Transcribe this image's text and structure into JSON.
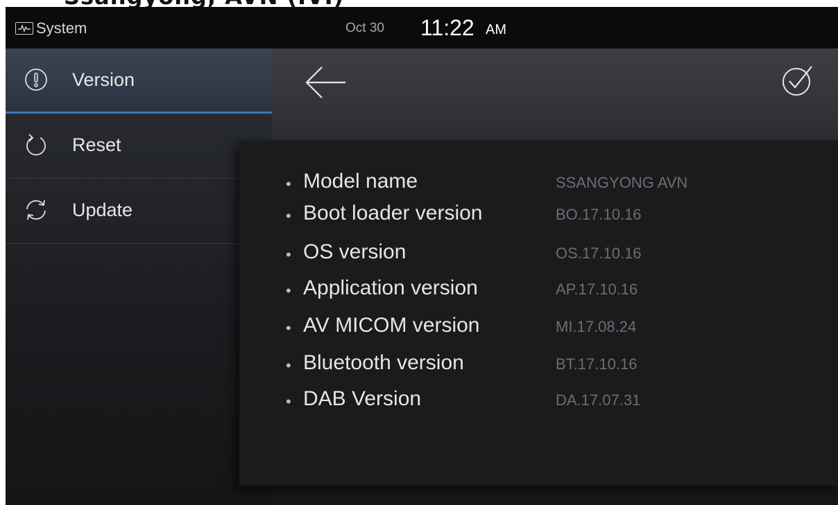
{
  "statusbar": {
    "section_icon": "activity-monitor-icon",
    "section_label": "System",
    "date": "Oct 30",
    "time": "11:22",
    "ampm": "AM"
  },
  "sidebar": {
    "items": [
      {
        "label": "Version",
        "icon": "info-exclamation-icon",
        "active": true
      },
      {
        "label": "Reset",
        "icon": "reset-arrow-icon",
        "active": false
      },
      {
        "label": "Update",
        "icon": "sync-arrows-icon",
        "active": false
      }
    ]
  },
  "toolbar": {
    "back_icon": "back-arrow-icon",
    "confirm_icon": "check-circle-icon"
  },
  "version_info": [
    {
      "label": "Model name",
      "value": "SSANGYONG AVN"
    },
    {
      "label": "Boot loader version",
      "value": "BO.17.10.16"
    },
    {
      "label": "OS version",
      "value": "OS.17.10.16"
    },
    {
      "label": "Application version",
      "value": "AP.17.10.16"
    },
    {
      "label": "AV MICOM version",
      "value": "MI.17.08.24"
    },
    {
      "label": "Bluetooth version",
      "value": "BT.17.10.16"
    },
    {
      "label": "DAB Version",
      "value": "DA.17.07.31"
    }
  ],
  "colors": {
    "active_accent": "#3b76b8",
    "background": "#1c1d20",
    "value_text": "#6c6e72"
  }
}
